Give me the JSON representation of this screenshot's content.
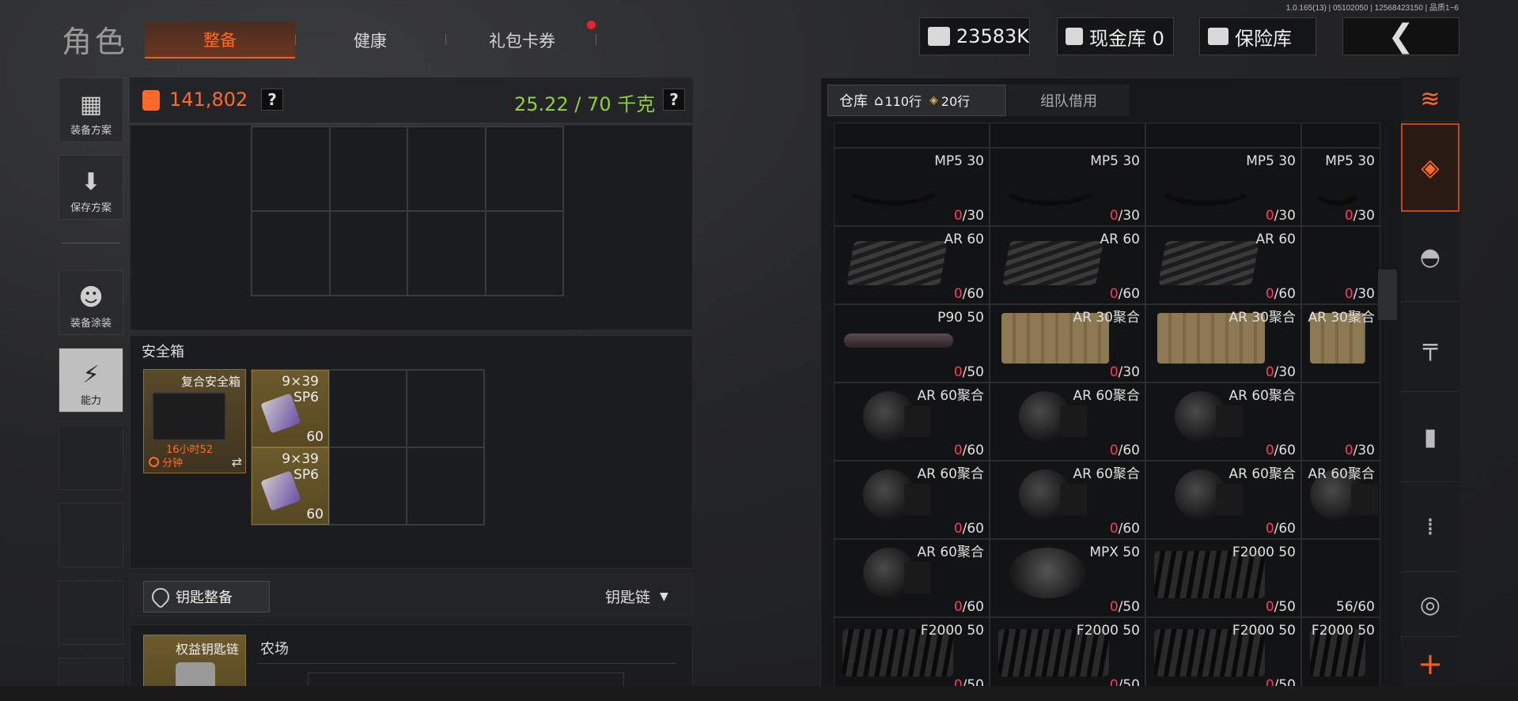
{
  "version": "1.0.165(13) | 05102050 | 12568423150 | 品质1~6",
  "title": "角色",
  "tabs": [
    {
      "label": "整备",
      "active": true
    },
    {
      "label": "健康",
      "active": false
    },
    {
      "label": "礼包卡券",
      "active": false
    }
  ],
  "top": {
    "money": "23583K",
    "cash_vault": "现金库 0",
    "insurance": "保险库",
    "back": "❮"
  },
  "sidebar": {
    "items": [
      {
        "label": "装备方案",
        "icon": "vest-icon"
      },
      {
        "label": "保存方案",
        "icon": "download-icon"
      },
      {
        "label": "装备涂装",
        "icon": "helmet-icon"
      },
      {
        "label": "能力",
        "icon": "lightning-icon",
        "active": true
      }
    ]
  },
  "loadout": {
    "value": "141,802",
    "help": "?",
    "weight": "25.22 / 70 千克",
    "help2": "?"
  },
  "safebox": {
    "title": "安全箱",
    "box_name": "复合安全箱",
    "timer": "16小时52",
    "timer_unit": "分钟",
    "items": [
      {
        "caliber": "9×39",
        "type": "SP6",
        "count": "60"
      },
      {
        "caliber": "9×39",
        "type": "SP6",
        "count": "60"
      }
    ]
  },
  "keys": {
    "button": "钥匙整备",
    "dropdown": "钥匙链",
    "chain_name": "权益钥匙链",
    "location": "农场"
  },
  "warehouse": {
    "tab_warehouse": "仓库",
    "rows_home": "110行",
    "rows_ticket": "20行",
    "tab_team": "组队借用",
    "cells": [
      {
        "name": "MP5 30",
        "zero": "0",
        "rest": "/30",
        "mag": "curve"
      },
      {
        "name": "MP5 30",
        "zero": "0",
        "rest": "/30",
        "mag": "curve"
      },
      {
        "name": "MP5 30",
        "zero": "0",
        "rest": "/30",
        "mag": "curve"
      },
      {
        "name": "MP5 30",
        "zero": "0",
        "rest": "/30",
        "mag": "curve"
      },
      {
        "name": "AR 60",
        "zero": "0",
        "rest": "/60",
        "mag": "ar"
      },
      {
        "name": "AR 60",
        "zero": "0",
        "rest": "/60",
        "mag": "ar"
      },
      {
        "name": "AR 60",
        "zero": "0",
        "rest": "/60",
        "mag": "ar"
      },
      {
        "name": "",
        "zero": "0",
        "rest": "/30",
        "mag": "none"
      },
      {
        "name": "P90 50",
        "zero": "0",
        "rest": "/50",
        "mag": "p90"
      },
      {
        "name": "AR 30聚合",
        "zero": "0",
        "rest": "/30",
        "mag": "tan"
      },
      {
        "name": "AR 30聚合",
        "zero": "0",
        "rest": "/30",
        "mag": "tan"
      },
      {
        "name": "AR 30聚合",
        "zero": "",
        "rest": "",
        "mag": "tan"
      },
      {
        "name": "AR 60聚合",
        "zero": "0",
        "rest": "/60",
        "mag": "drum"
      },
      {
        "name": "AR 60聚合",
        "zero": "0",
        "rest": "/60",
        "mag": "drum"
      },
      {
        "name": "AR 60聚合",
        "zero": "0",
        "rest": "/60",
        "mag": "drum"
      },
      {
        "name": "",
        "zero": "0",
        "rest": "/30",
        "mag": "none"
      },
      {
        "name": "AR 60聚合",
        "zero": "0",
        "rest": "/60",
        "mag": "drum"
      },
      {
        "name": "AR 60聚合",
        "zero": "0",
        "rest": "/60",
        "mag": "drum"
      },
      {
        "name": "AR 60聚合",
        "zero": "0",
        "rest": "/60",
        "mag": "drum"
      },
      {
        "name": "AR 60聚合",
        "zero": "",
        "rest": "",
        "mag": "drum"
      },
      {
        "name": "AR 60聚合",
        "zero": "0",
        "rest": "/60",
        "mag": "drum"
      },
      {
        "name": "MPX 50",
        "zero": "0",
        "rest": "/50",
        "mag": "mpx"
      },
      {
        "name": "F2000 50",
        "zero": "0",
        "rest": "/50",
        "mag": "f2000"
      },
      {
        "name": "",
        "zero": "",
        "rest": "56/60",
        "mag": "none"
      },
      {
        "name": "F2000 50",
        "zero": "0",
        "rest": "/50",
        "mag": "f2000"
      },
      {
        "name": "F2000 50",
        "zero": "0",
        "rest": "/50",
        "mag": "f2000"
      },
      {
        "name": "F2000 50",
        "zero": "0",
        "rest": "/50",
        "mag": "f2000"
      },
      {
        "name": "F2000 50",
        "zero": "",
        "rest": "",
        "mag": "f2000"
      }
    ]
  },
  "right_rail": [
    {
      "icon": "sort-icon"
    },
    {
      "icon": "layers-icon",
      "active": true
    },
    {
      "icon": "helmet-icon"
    },
    {
      "icon": "rifle-icon"
    },
    {
      "icon": "magazine-icon"
    },
    {
      "icon": "ammo-icon"
    },
    {
      "icon": "scope-icon"
    },
    {
      "icon": "plus-icon",
      "label": "+"
    }
  ],
  "colors": {
    "accent": "#ff6a2a",
    "weight_ok": "#8fd13a",
    "empty_count": "#ff3a5a"
  }
}
